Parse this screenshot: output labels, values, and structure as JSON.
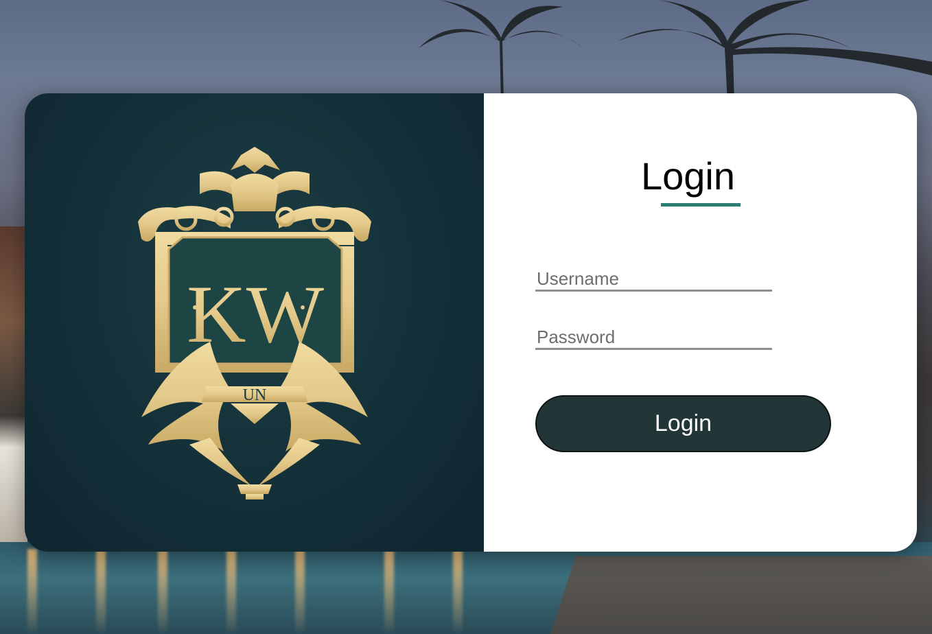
{
  "login": {
    "title": "Login",
    "username_placeholder": "Username",
    "password_placeholder": "Password",
    "submit_label": "Login"
  },
  "logo": {
    "monogram": "KW",
    "ribbon": "UN"
  },
  "colors": {
    "accent": "#2b7c72",
    "button_bg": "#223637",
    "panel_bg": "#15323a",
    "gold": "#e3c98a"
  }
}
